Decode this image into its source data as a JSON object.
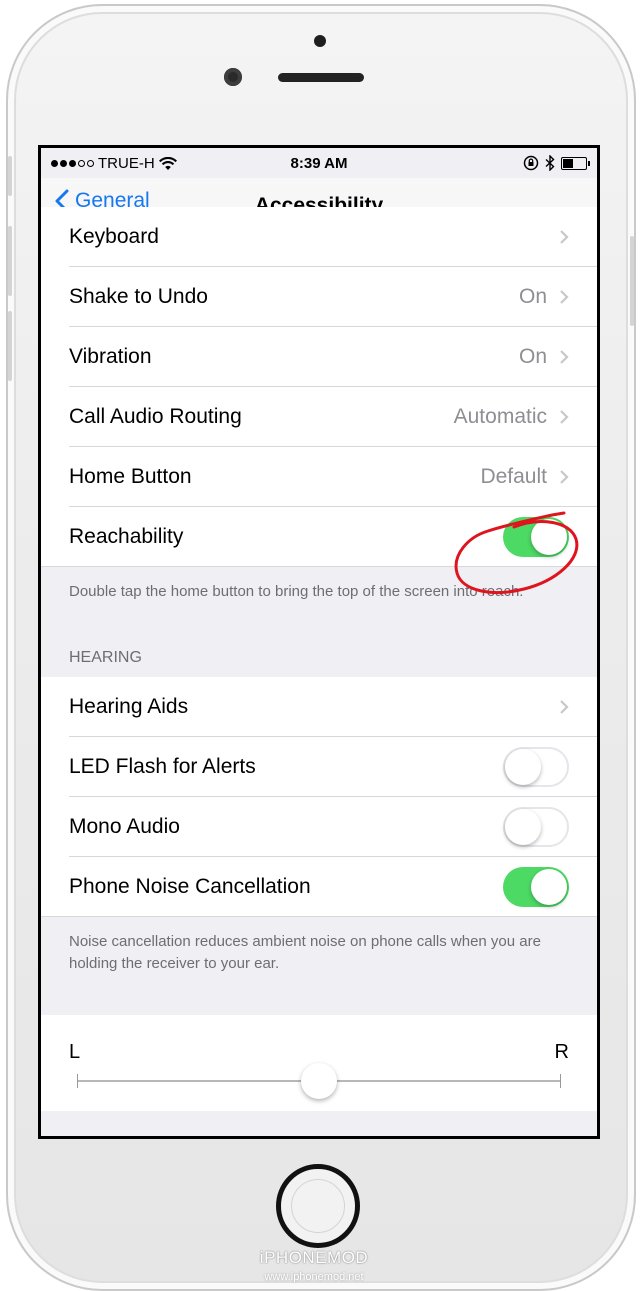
{
  "status_bar": {
    "signal_strength": 3,
    "signal_max": 5,
    "carrier": "TRUE-H",
    "time": "8:39 AM",
    "battery_level": 0.45
  },
  "nav": {
    "back_label": "General",
    "title": "Accessibility"
  },
  "rows_top": [
    {
      "label": "Keyboard",
      "value": "",
      "control": "chevron"
    },
    {
      "label": "Shake to Undo",
      "value": "On",
      "control": "chevron"
    },
    {
      "label": "Vibration",
      "value": "On",
      "control": "chevron"
    },
    {
      "label": "Call Audio Routing",
      "value": "Automatic",
      "control": "chevron"
    },
    {
      "label": "Home Button",
      "value": "Default",
      "control": "chevron"
    },
    {
      "label": "Reachability",
      "value": "",
      "control": "switch",
      "on": true
    }
  ],
  "reachability_footer": "Double tap the home button to bring the top of the screen into reach.",
  "hearing": {
    "header": "HEARING",
    "rows": [
      {
        "label": "Hearing Aids",
        "value": "",
        "control": "chevron"
      },
      {
        "label": "LED Flash for Alerts",
        "value": "",
        "control": "switch",
        "on": false
      },
      {
        "label": "Mono Audio",
        "value": "",
        "control": "switch",
        "on": false
      },
      {
        "label": "Phone Noise Cancellation",
        "value": "",
        "control": "switch",
        "on": true
      }
    ],
    "footer": "Noise cancellation reduces ambient noise on phone calls when you are holding the receiver to your ear."
  },
  "balance": {
    "left_label": "L",
    "right_label": "R",
    "value": 0.5
  },
  "colors": {
    "accent": "#1677f0",
    "switch_on": "#4cd964",
    "annotation": "#e0141e"
  },
  "watermark": {
    "brand": "iPHONEMOD",
    "url": "www.iphonemod.net"
  }
}
